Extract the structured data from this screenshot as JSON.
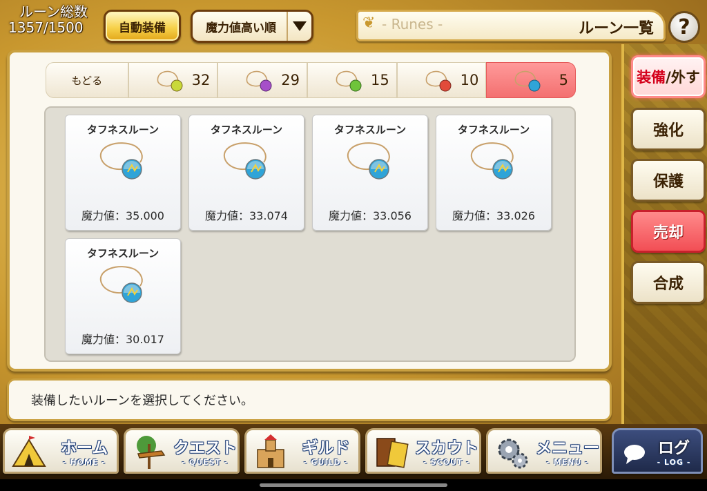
{
  "header": {
    "rune_count_label": "ルーン総数",
    "rune_count_value": "1357/1500",
    "auto_equip_label": "自動装備",
    "sort_label": "魔力値高い順",
    "title_sub": "- Runes -",
    "title_main": "ルーン一覧",
    "help_label": "?"
  },
  "tabs": [
    {
      "label": "もどる",
      "count": ""
    },
    {
      "label": "",
      "count": "32",
      "color": "#c9d93a"
    },
    {
      "label": "",
      "count": "29",
      "color": "#a64fc9"
    },
    {
      "label": "",
      "count": "15",
      "color": "#6fc43b"
    },
    {
      "label": "",
      "count": "10",
      "color": "#e24b3a"
    },
    {
      "label": "",
      "count": "5",
      "color": "#2fa4d8",
      "active": true
    }
  ],
  "runes": [
    {
      "name": "タフネスルーン",
      "power": "魔力値：35.000"
    },
    {
      "name": "タフネスルーン",
      "power": "魔力値：33.074"
    },
    {
      "name": "タフネスルーン",
      "power": "魔力値：33.056"
    },
    {
      "name": "タフネスルーン",
      "power": "魔力値：33.026"
    },
    {
      "name": "タフネスルーン",
      "power": "魔力値：30.017"
    }
  ],
  "side_buttons": {
    "equip_part1": "装備",
    "equip_part2": "/外す",
    "enhance": "強化",
    "protect": "保護",
    "sell": "売却",
    "combine": "合成"
  },
  "message": "装備したいルーンを選択してください。",
  "nav": [
    {
      "big": "ホーム",
      "small": "- HOME -"
    },
    {
      "big": "クエスト",
      "small": "- QUEST -"
    },
    {
      "big": "ギルド",
      "small": "- GUILD -"
    },
    {
      "big": "スカウト",
      "small": "- SCOUT -"
    },
    {
      "big": "メニュー",
      "small": "- MENU -"
    },
    {
      "big": "ログ",
      "small": "- LOG -"
    }
  ],
  "colors": {
    "accent_red": "#f37070",
    "gold": "#c9a040",
    "rune_blue": "#2fa4d8"
  }
}
